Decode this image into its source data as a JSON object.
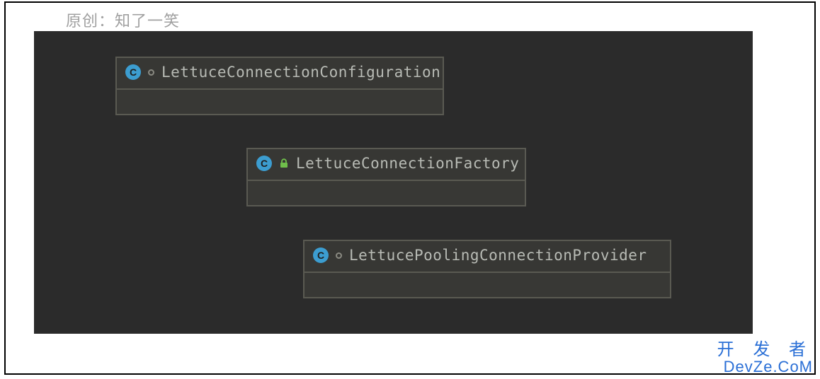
{
  "attribution": "原创：知了一笑",
  "classes": [
    {
      "name": "LettuceConnectionConfiguration",
      "modifier": "circle"
    },
    {
      "name": "LettuceConnectionFactory",
      "modifier": "lock"
    },
    {
      "name": "LettucePoolingConnectionProvider",
      "modifier": "circle"
    }
  ],
  "badge_letter": "C",
  "watermark": {
    "line1": "开 发 者",
    "line2": "DevZe.CoM"
  },
  "colors": {
    "panel_bg": "#2b2b2b",
    "box_border": "#5a5a52",
    "class_text": "#b8bbb5",
    "badge_bg": "#3c9dd0",
    "lock_color": "#6fbf4b",
    "watermark": "#2a6fd6"
  }
}
